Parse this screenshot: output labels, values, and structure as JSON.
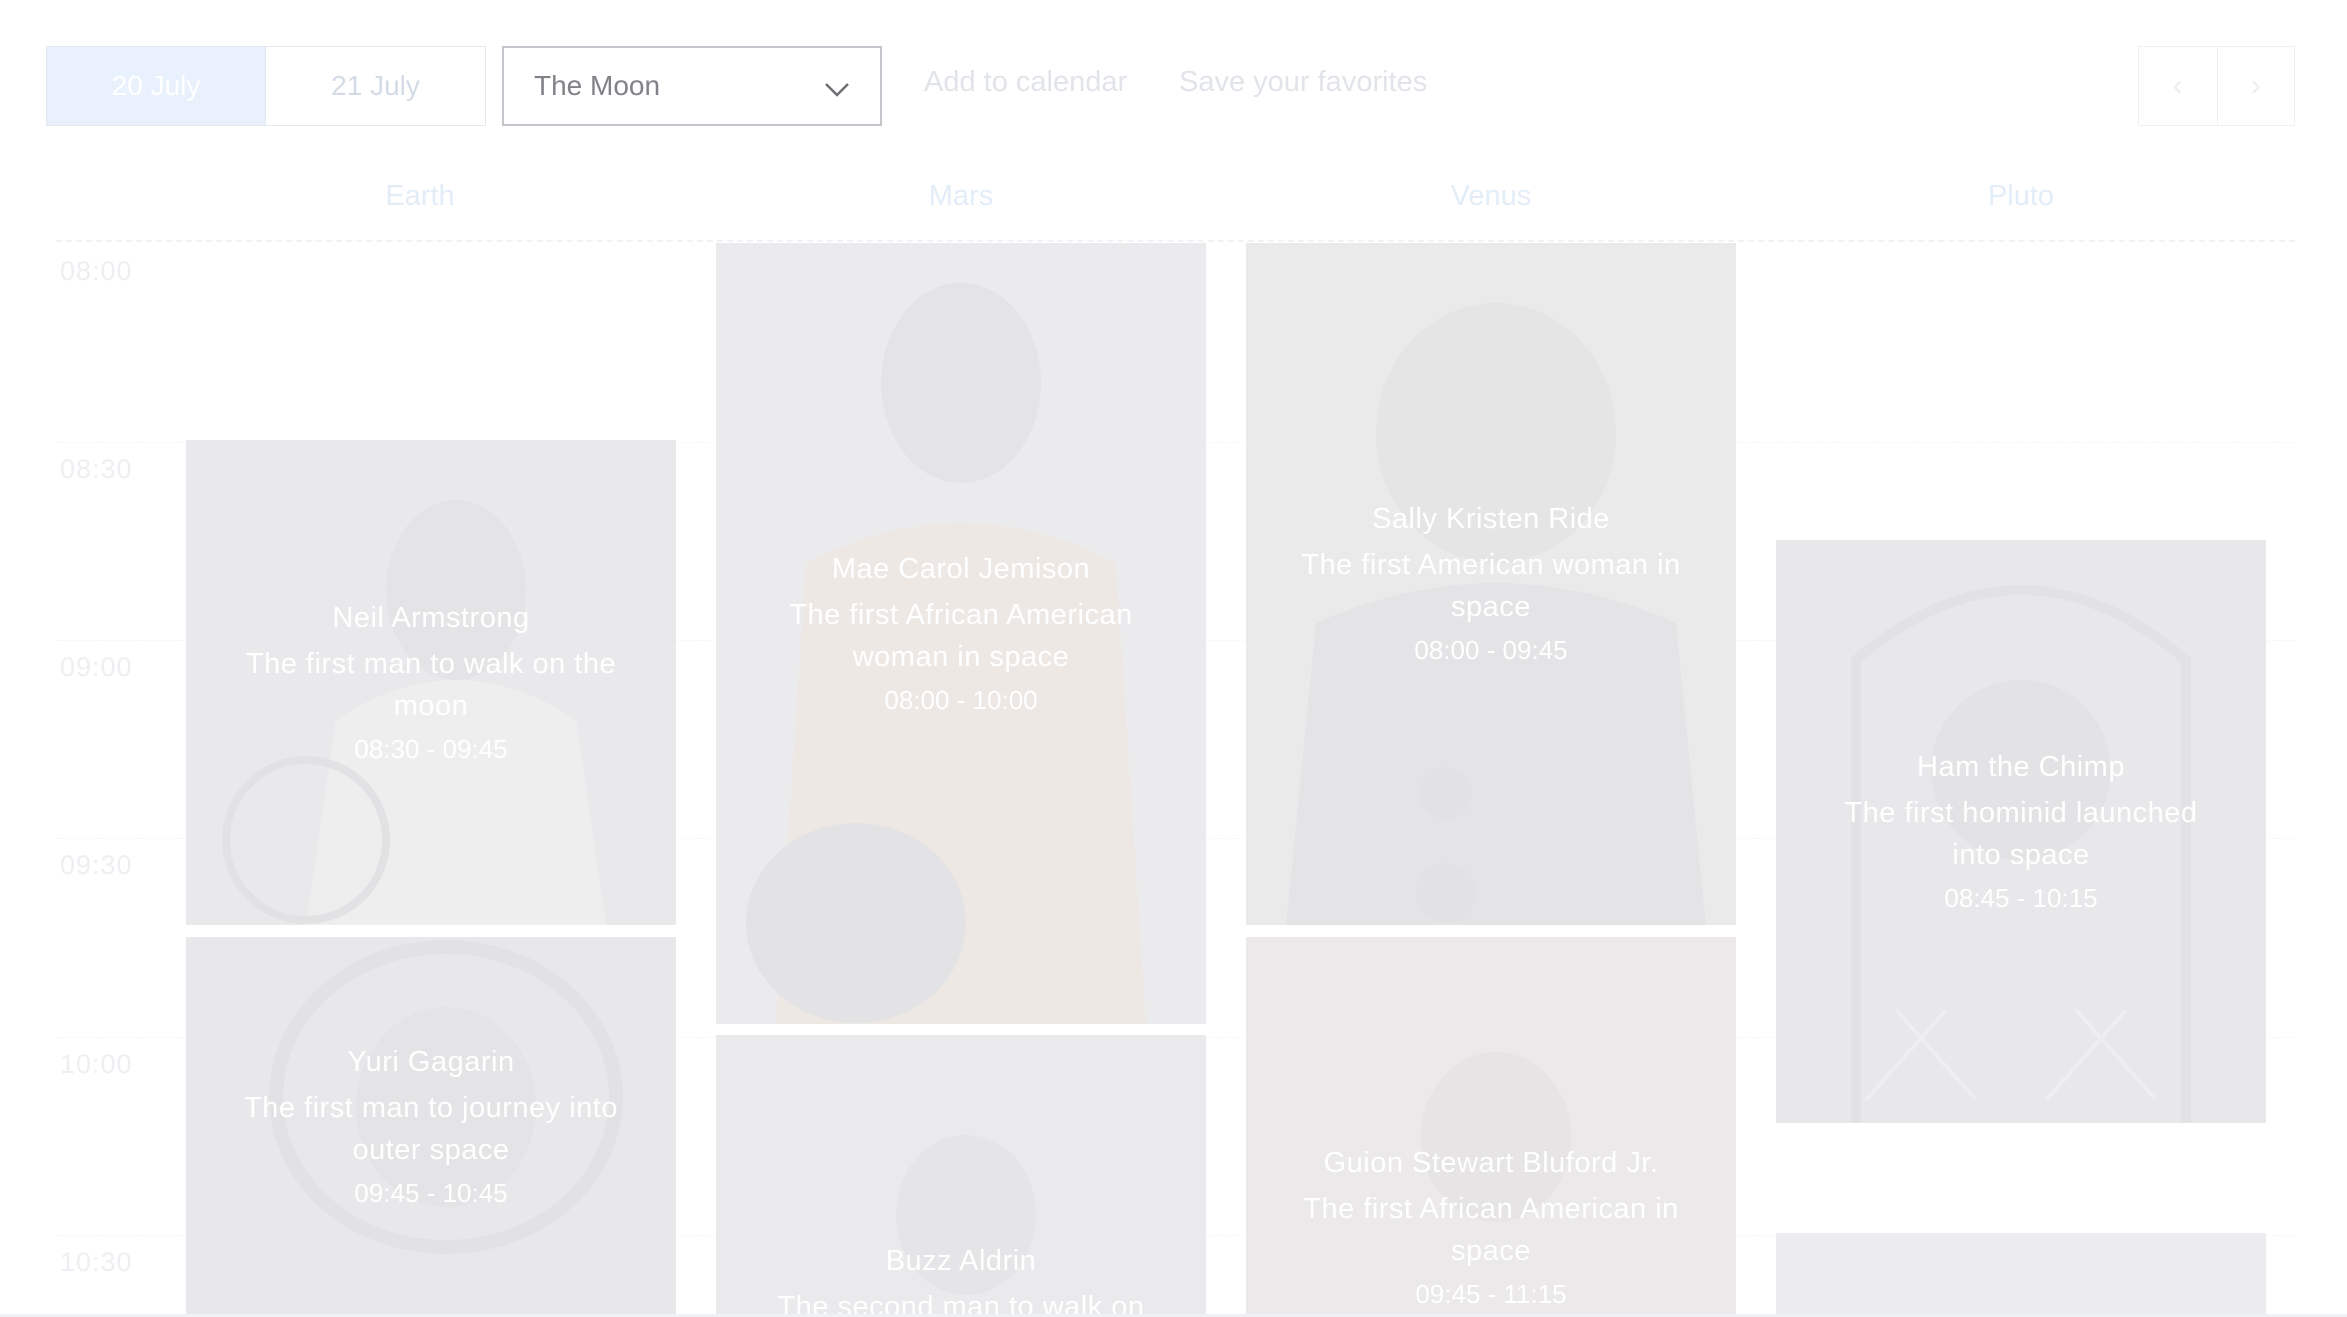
{
  "toolbar": {
    "days": [
      {
        "label": "20 July",
        "active": true
      },
      {
        "label": "21 July",
        "active": false
      }
    ],
    "room_select": {
      "value": "The Moon",
      "icon": "chevron-down-icon"
    },
    "add_to_calendar": "Add to calendar",
    "save_favorites": "Save your favorites",
    "prev_icon": "‹",
    "next_icon": "›"
  },
  "columns": [
    "Earth",
    "Mars",
    "Venus",
    "Pluto"
  ],
  "times": [
    "08:00",
    "08:30",
    "09:00",
    "09:30",
    "10:00",
    "10:30"
  ],
  "events": [
    {
      "name": "Neil Armstrong",
      "description": "The first man to walk on the moon",
      "time": "08:30 - 09:45",
      "column": "Earth"
    },
    {
      "name": "Yuri Gagarin",
      "description": "The first man to journey into outer space",
      "time": "09:45 - 10:45",
      "column": "Earth"
    },
    {
      "name": "Mae Carol Jemison",
      "description": "The first African American woman in space",
      "time": "08:00 - 10:00",
      "column": "Mars"
    },
    {
      "name": "Buzz Aldrin",
      "description": "The second man to walk on",
      "time": "",
      "column": "Mars"
    },
    {
      "name": "Sally Kristen Ride",
      "description": "The first American woman in space",
      "time": "08:00 - 09:45",
      "column": "Venus"
    },
    {
      "name": "Guion Stewart Bluford Jr.",
      "description": "The first African American in space",
      "time": "09:45 - 11:15",
      "column": "Venus"
    },
    {
      "name": "Ham the Chimp",
      "description": "The first hominid launched into space",
      "time": "08:45 - 10:15",
      "column": "Pluto"
    },
    {
      "name": "",
      "description": "",
      "time": "",
      "column": "Pluto"
    }
  ]
}
